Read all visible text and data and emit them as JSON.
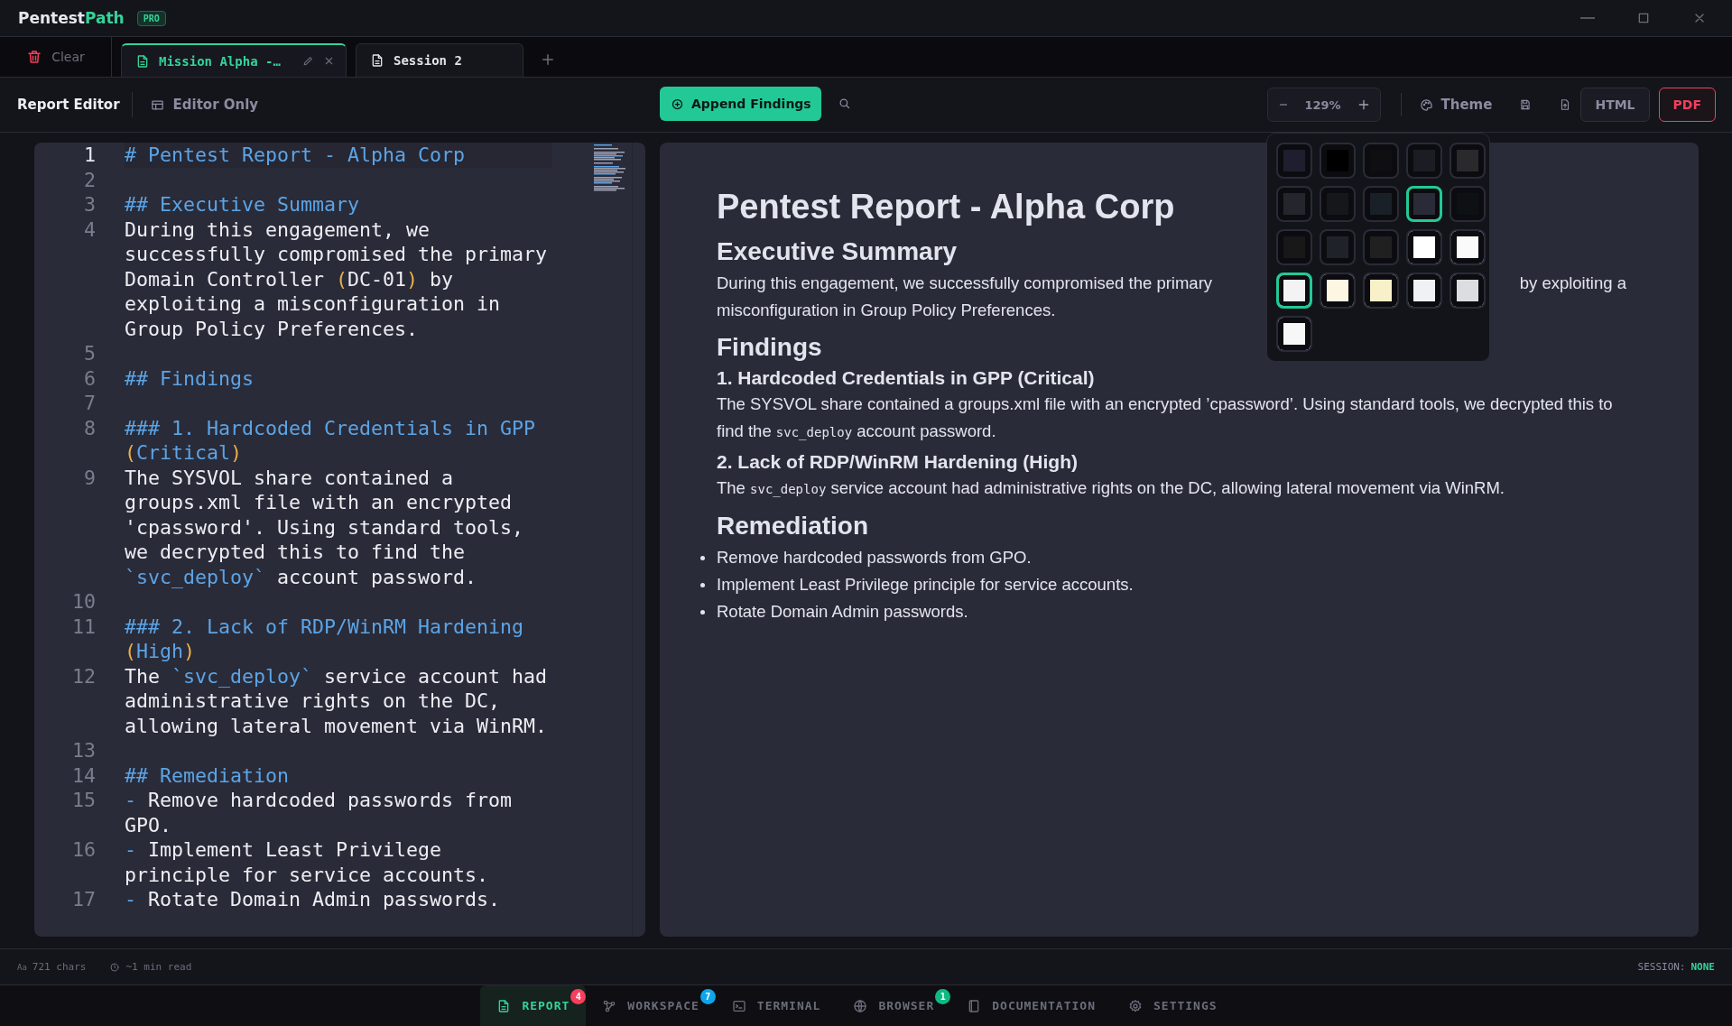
{
  "app": {
    "name_first": "Pentest",
    "name_second": "Path",
    "badge": "PRO"
  },
  "tabs_bar": {
    "clear_label": "Clear",
    "tabs": [
      {
        "label": "Mission Alpha -…",
        "selected": true,
        "editable": true
      },
      {
        "label": "Session 2",
        "selected": false,
        "editable": false
      }
    ]
  },
  "toolbar": {
    "title": "Report Editor",
    "view_toggle": "Editor Only",
    "append_button": "Append Findings",
    "zoom": "129%",
    "theme_button": "Theme",
    "export_buttons": [
      {
        "label": "HTML",
        "kind": "plain"
      },
      {
        "label": "PDF",
        "kind": "danger"
      }
    ]
  },
  "editor": {
    "lines": [
      {
        "number": "1",
        "active": true,
        "segments": [
          {
            "kind": "heading",
            "text": "# Pentest Report - Alpha Corp"
          }
        ]
      },
      {
        "number": "2",
        "active": false
      },
      {
        "number": "3",
        "active": false,
        "segments": [
          {
            "kind": "heading",
            "text": "## Executive Summary"
          }
        ]
      },
      {
        "number": "4",
        "active": false,
        "segments": [
          {
            "kind": "plain",
            "text": "During this engagement, we successfully compromised the primary Domain Controller "
          },
          {
            "kind": "paren",
            "text": "("
          },
          {
            "kind": "plain",
            "text": "DC-01"
          },
          {
            "kind": "paren",
            "text": ")"
          },
          {
            "kind": "plain",
            "text": " by exploiting a misconfiguration in Group Policy Preferences."
          }
        ]
      },
      {
        "number": "5",
        "active": false
      },
      {
        "number": "6",
        "active": false,
        "segments": [
          {
            "kind": "heading",
            "text": "## Findings"
          }
        ]
      },
      {
        "number": "7",
        "active": false
      },
      {
        "number": "8",
        "active": false,
        "segments": [
          {
            "kind": "heading",
            "text": "### 1. Hardcoded Credentials in GPP "
          },
          {
            "kind": "paren",
            "text": "("
          },
          {
            "kind": "heading",
            "text": "Critical"
          },
          {
            "kind": "paren",
            "text": ")"
          }
        ]
      },
      {
        "number": "9",
        "active": false,
        "segments": [
          {
            "kind": "plain",
            "text": "The SYSVOL share contained a groups.xml file with an encrypted 'cpassword'. Using standard tools, we decrypted this to find the "
          },
          {
            "kind": "code",
            "text": "`svc_deploy`"
          },
          {
            "kind": "plain",
            "text": " account password."
          }
        ]
      },
      {
        "number": "10",
        "active": false
      },
      {
        "number": "11",
        "active": false,
        "segments": [
          {
            "kind": "heading",
            "text": "### 2. Lack of RDP/WinRM Hardening "
          },
          {
            "kind": "paren",
            "text": "("
          },
          {
            "kind": "heading",
            "text": "High"
          },
          {
            "kind": "paren",
            "text": ")"
          }
        ]
      },
      {
        "number": "12",
        "active": false,
        "segments": [
          {
            "kind": "plain",
            "text": "The "
          },
          {
            "kind": "code",
            "text": "`svc_deploy`"
          },
          {
            "kind": "plain",
            "text": " service account had administrative rights on the DC, allowing lateral movement via WinRM."
          }
        ]
      },
      {
        "number": "13",
        "active": false
      },
      {
        "number": "14",
        "active": false,
        "segments": [
          {
            "kind": "heading",
            "text": "## Remediation"
          }
        ]
      },
      {
        "number": "15",
        "active": false,
        "segments": [
          {
            "kind": "heading",
            "text": "- "
          },
          {
            "kind": "plain",
            "text": "Remove hardcoded passwords from GPO."
          }
        ]
      },
      {
        "number": "16",
        "active": false,
        "segments": [
          {
            "kind": "heading",
            "text": "- "
          },
          {
            "kind": "plain",
            "text": "Implement Least Privilege principle for service accounts."
          }
        ]
      },
      {
        "number": "17",
        "active": false,
        "segments": [
          {
            "kind": "heading",
            "text": "- "
          },
          {
            "kind": "plain",
            "text": "Rotate Domain Admin passwords."
          }
        ]
      }
    ]
  },
  "preview": {
    "blocks": [
      {
        "kind": "h1",
        "text": "Pentest Report - Alpha Corp"
      },
      {
        "kind": "h2",
        "text": "Executive Summary"
      },
      {
        "kind": "p-covered",
        "text_left": "During this engagement, we successfully compromised the primary",
        "text_right": "by exploiting a",
        "text_next": "misconfiguration in Group Policy Preferences."
      },
      {
        "kind": "h2",
        "text": "Findings"
      },
      {
        "kind": "h3",
        "text": "1. Hardcoded Credentials in GPP (Critical)"
      },
      {
        "kind": "p",
        "segments": [
          {
            "kind": "plain",
            "text": "The SYSVOL share contained a groups.xml file with an encrypted ’cpassword’. Using standard tools, we decrypted this to find the"
          },
          {
            "kind": "code",
            "text": "svc_deploy"
          },
          {
            "kind": "plain",
            "text": "account password."
          }
        ]
      },
      {
        "kind": "h3",
        "text": "2. Lack of RDP/WinRM Hardening (High)"
      },
      {
        "kind": "p",
        "segments": [
          {
            "kind": "plain",
            "text": "The"
          },
          {
            "kind": "code",
            "text": "svc_deploy"
          },
          {
            "kind": "plain",
            "text": "service account had administrative rights on the DC, allowing lateral movement via WinRM."
          }
        ]
      },
      {
        "kind": "h2",
        "text": "Remediation"
      },
      {
        "kind": "li",
        "text": "Remove hardcoded passwords from GPO."
      },
      {
        "kind": "li",
        "text": "Implement Least Privilege principle for service accounts."
      },
      {
        "kind": "li",
        "text": "Rotate Domain Admin passwords."
      }
    ]
  },
  "theme_picker": {
    "swatches": [
      {
        "color": "#1e1e2e",
        "selected": false
      },
      {
        "color": "#000000",
        "selected": false
      },
      {
        "color": "#0f0f12",
        "selected": false
      },
      {
        "color": "#1c1c24",
        "selected": false
      },
      {
        "color": "#2a2a2c",
        "selected": false
      },
      {
        "color": "#25262d",
        "selected": false
      },
      {
        "color": "#16171b",
        "selected": false
      },
      {
        "color": "#1a2028",
        "selected": false
      },
      {
        "color": "#2a2b38",
        "selected": true
      },
      {
        "color": "#0d1114",
        "selected": false
      },
      {
        "color": "#181818",
        "selected": false
      },
      {
        "color": "#1f2329",
        "selected": false
      },
      {
        "color": "#202020",
        "selected": false
      },
      {
        "color": "#ffffff",
        "selected": false
      },
      {
        "color": "#fafafa",
        "selected": false
      },
      {
        "color": "#f3f3f3",
        "selected": true
      },
      {
        "color": "#fdf6e3",
        "selected": false
      },
      {
        "color": "#f8f0c8",
        "selected": false
      },
      {
        "color": "#eff1f5",
        "selected": false
      },
      {
        "color": "#dcdde1",
        "selected": false
      },
      {
        "color": "#f7f7f7",
        "selected": false
      }
    ]
  },
  "status_bar": {
    "chars_icon": "Aa",
    "chars": "721 chars",
    "read_time": "~1 min read",
    "session_label": "SESSION:",
    "session_value": "NONE"
  },
  "bottom_nav": [
    {
      "label": "REPORT",
      "kind": "report",
      "selected": true,
      "badge": "4",
      "color": "#f43f5e"
    },
    {
      "label": "WORKSPACE",
      "kind": "workspace",
      "selected": false,
      "badge": "7",
      "color": "#0ea5e9"
    },
    {
      "label": "TERMINAL",
      "kind": "terminal",
      "selected": false
    },
    {
      "label": "BROWSER",
      "kind": "browser",
      "selected": false,
      "badge": "1",
      "color": "#10b981"
    },
    {
      "label": "DOCUMENTATION",
      "kind": "docs",
      "selected": false
    },
    {
      "label": "SETTINGS",
      "kind": "settings",
      "selected": false
    }
  ]
}
